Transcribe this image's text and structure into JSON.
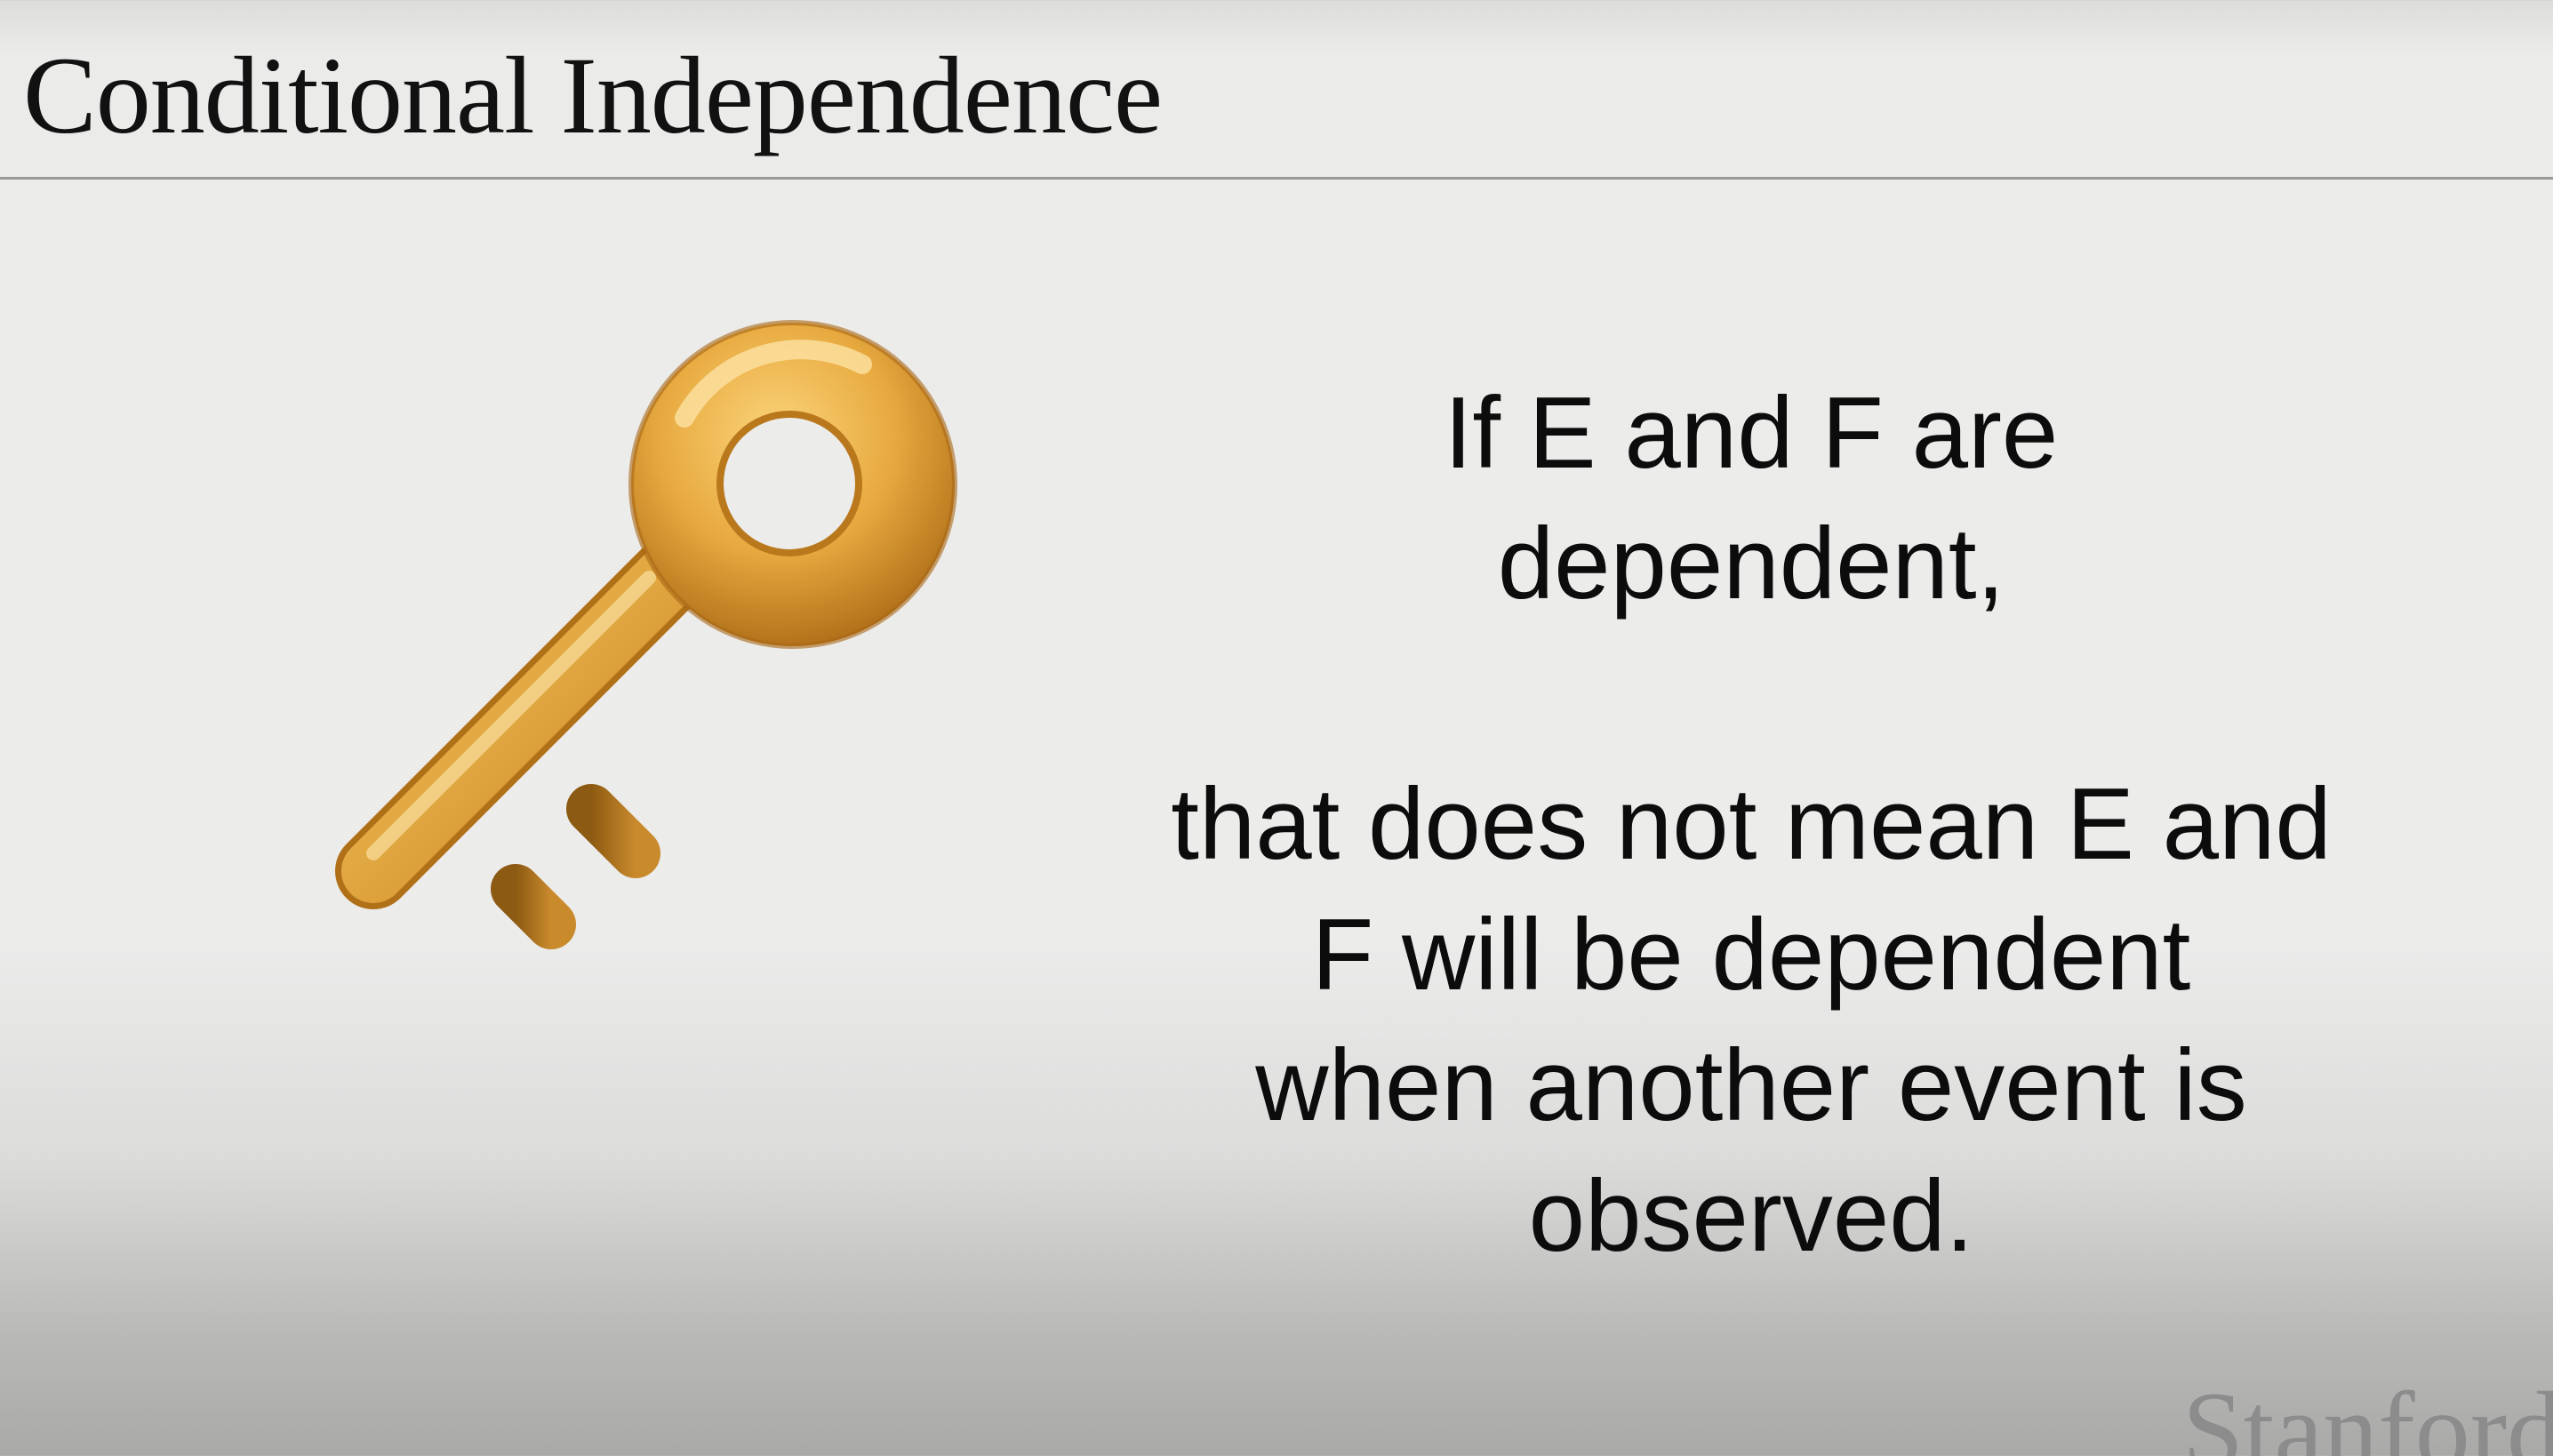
{
  "slide": {
    "title": "Conditional Independence",
    "paragraph_1": [
      "If E and F are",
      "dependent,"
    ],
    "paragraph_2": [
      "that does not mean E and",
      "F will be dependent",
      "when another event is",
      "observed."
    ],
    "illustration_icon": "old-key-icon",
    "logo_text": "Stanford"
  },
  "colors": {
    "key_gold": "#e2a63a",
    "key_dark": "#b3721a",
    "key_light": "#fbd47a",
    "text": "#0c0c0c",
    "rule": "#9a9a9a"
  }
}
